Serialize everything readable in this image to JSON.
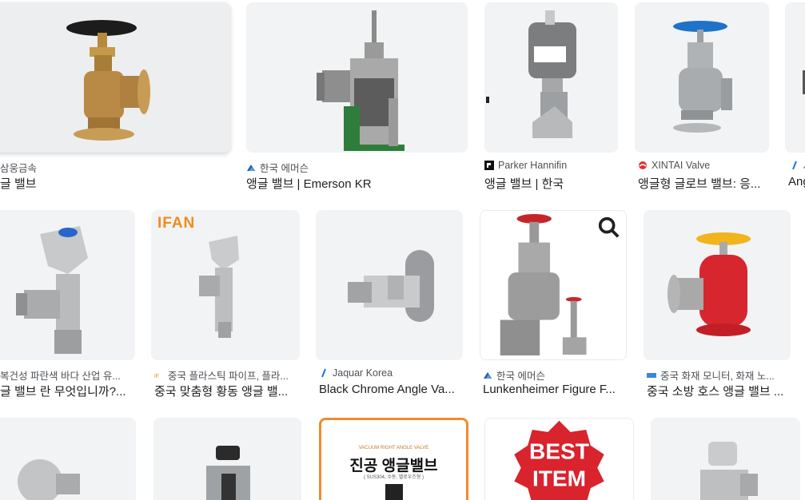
{
  "row1": [
    {
      "source": "삼웅금속",
      "title": "글 밸브"
    },
    {
      "source": "한국 에머슨",
      "title": "앵글 밸브 | Emerson KR"
    },
    {
      "source": "Parker Hannifin",
      "title": "앵글 밸브 | 한국"
    },
    {
      "source": "XINTAI Valve",
      "title": "앵글형 글로브 밸브: 응..."
    },
    {
      "source": "J",
      "title": "Ang"
    }
  ],
  "row2": [
    {
      "source": "복건성 파란색 바다 산업 유...",
      "title": "글 밸브 란 무엇입니까?..."
    },
    {
      "source": "중국 플라스틱 파이프, 플라...",
      "title": "중국 맞춤형 황동 앵글 밸...",
      "brand": "IFAN"
    },
    {
      "source": "Jaquar Korea",
      "title": "Black Chrome Angle Va..."
    },
    {
      "source": "한국 에머슨",
      "title": "Lunkenheimer Figure F..."
    },
    {
      "source": "중국 화재 모니터, 화재 노...",
      "title": "중국 소방 호스 앵글 밸브 ..."
    }
  ],
  "row3": [
    {
      "banner_small": "VACUUM RIGHT ANGLE VALVE",
      "banner_title": "진공 앵글밸브",
      "banner_sub": "( SUS304, 수동, 벨로우즈형 )"
    },
    {
      "badge": "BEST ITEM"
    }
  ],
  "icons": {
    "lens": "search-icon"
  },
  "colors": {
    "thumb_bg": "#f1f3f4",
    "source_text": "#4d5156",
    "title_text": "#202124",
    "ifan": "#f08a1c",
    "best_badge": "#d9232d"
  }
}
